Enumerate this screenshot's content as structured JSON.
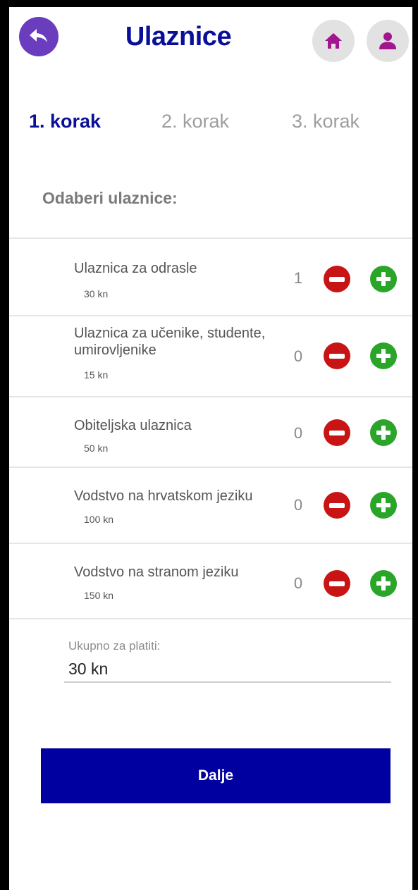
{
  "header": {
    "title": "Ulaznice",
    "back_icon": "back-arrow-icon",
    "home_icon": "home-icon",
    "user_icon": "user-icon",
    "colors": {
      "title": "#0a0f9a",
      "back": "#6a3dbf",
      "icon": "#a0178f",
      "icon_bg": "#e2e2e2"
    }
  },
  "steps": [
    {
      "label": "1. korak",
      "active": true
    },
    {
      "label": "2. korak",
      "active": false
    },
    {
      "label": "3. korak",
      "active": false
    }
  ],
  "section_title": "Odaberi ulaznice:",
  "tickets": [
    {
      "name": "Ulaznica za odrasle",
      "price": "30 kn",
      "qty": "1"
    },
    {
      "name": "Ulaznica za učenike, studente,\n umirovljenike",
      "price": "15 kn",
      "qty": "0"
    },
    {
      "name": "Obiteljska ulaznica",
      "price": "50 kn",
      "qty": "0"
    },
    {
      "name": "Vodstvo na hrvatskom jeziku",
      "price": "100 kn",
      "qty": "0"
    },
    {
      "name": "Vodstvo na stranom jeziku",
      "price": "150 kn",
      "qty": "0"
    }
  ],
  "controls": {
    "minus_icon": "minus-circle-icon",
    "plus_icon": "plus-circle-icon",
    "minus_color": "#c81414",
    "plus_color": "#2aa52a"
  },
  "total": {
    "label": "Ukupno za platiti:",
    "value": "30 kn"
  },
  "next_button": {
    "label": "Dalje",
    "color": "#0000a0"
  }
}
